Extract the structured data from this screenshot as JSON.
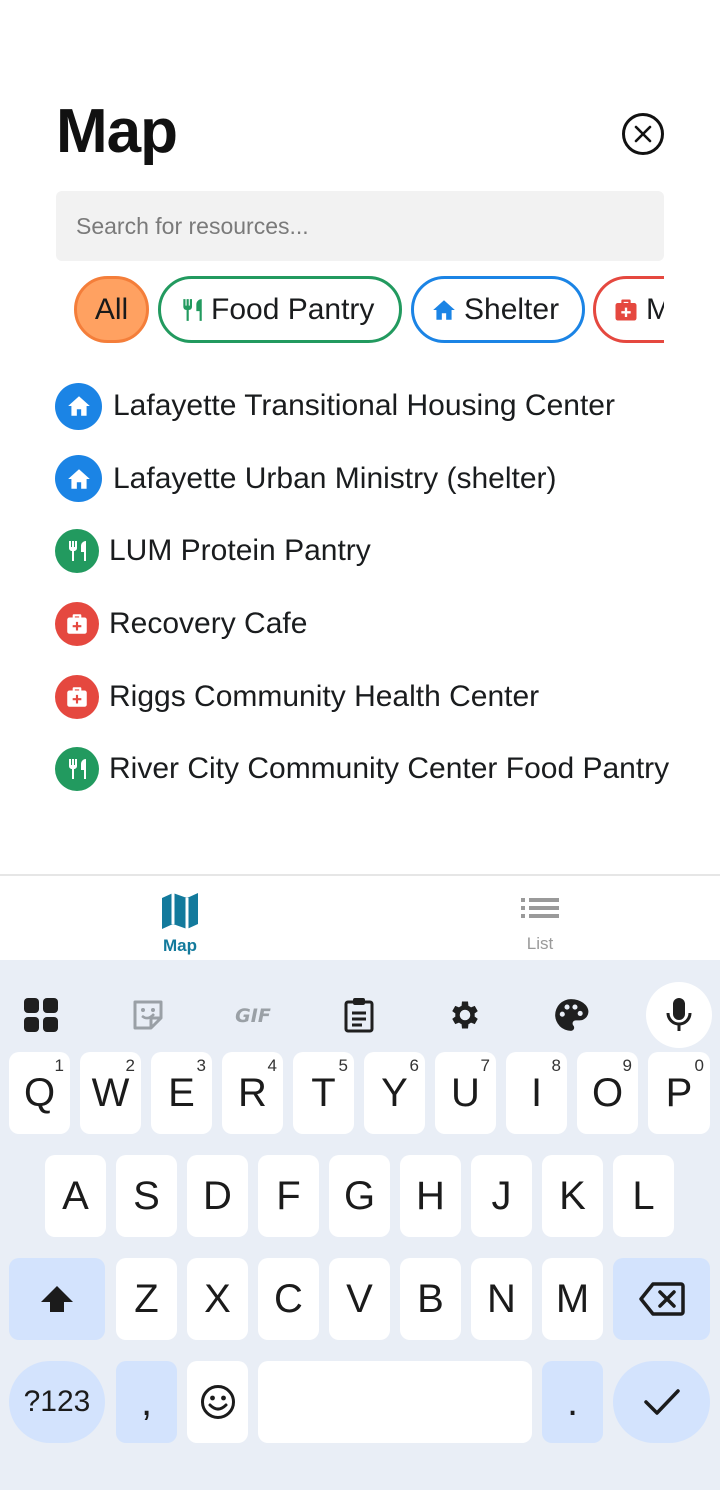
{
  "header": {
    "title": "Map"
  },
  "search": {
    "placeholder": "Search for resources..."
  },
  "filters": {
    "all": "All",
    "food": "Food Pantry",
    "shelter": "Shelter",
    "medical": "M"
  },
  "resources": [
    {
      "type": "shelter",
      "name": "Lafayette Transitional Housing Center",
      "icon": "house-icon"
    },
    {
      "type": "shelter",
      "name": "Lafayette Urban Ministry (shelter)",
      "icon": "house-icon"
    },
    {
      "type": "food",
      "name": "LUM Protein Pantry",
      "icon": "fork-knife-icon"
    },
    {
      "type": "medical",
      "name": "Recovery Cafe",
      "icon": "medical-kit-icon"
    },
    {
      "type": "medical",
      "name": "Riggs Community Health Center",
      "icon": "medical-kit-icon"
    },
    {
      "type": "food",
      "name": "River City Community Center Food Pantry",
      "icon": "fork-knife-icon"
    }
  ],
  "tabs": {
    "map": "Map",
    "list": "List"
  },
  "keyboard": {
    "row1": [
      {
        "key": "Q",
        "hint": "1"
      },
      {
        "key": "W",
        "hint": "2"
      },
      {
        "key": "E",
        "hint": "3"
      },
      {
        "key": "R",
        "hint": "4"
      },
      {
        "key": "T",
        "hint": "5"
      },
      {
        "key": "Y",
        "hint": "6"
      },
      {
        "key": "U",
        "hint": "7"
      },
      {
        "key": "I",
        "hint": "8"
      },
      {
        "key": "O",
        "hint": "9"
      },
      {
        "key": "P",
        "hint": "0"
      }
    ],
    "row2": [
      "A",
      "S",
      "D",
      "F",
      "G",
      "H",
      "J",
      "K",
      "L"
    ],
    "row3": [
      "Z",
      "X",
      "C",
      "V",
      "B",
      "N",
      "M"
    ],
    "symbols": "?123",
    "comma": ",",
    "period": "."
  },
  "colors": {
    "shelter": "#1b84e5",
    "food": "#229a5f",
    "medical": "#e5483f",
    "all_fill": "#ffa161",
    "active_tab": "#137a9c"
  }
}
